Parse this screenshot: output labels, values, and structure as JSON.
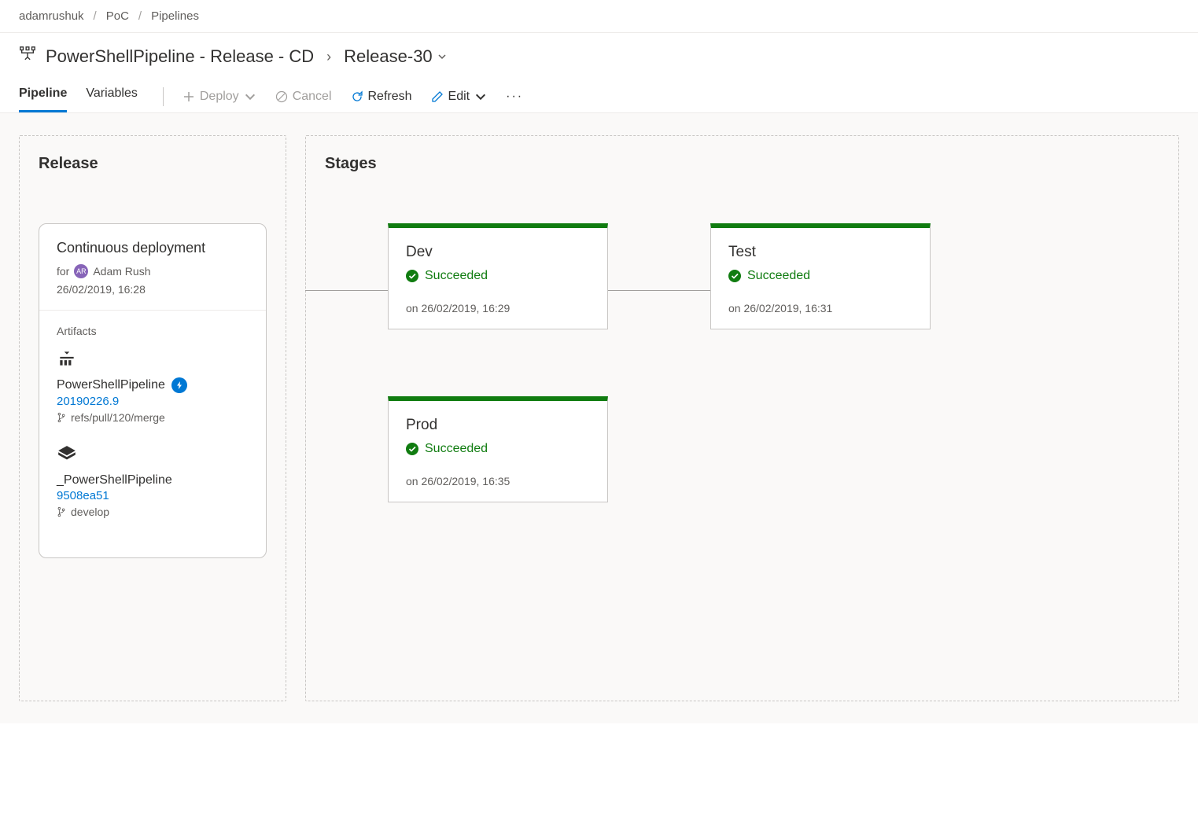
{
  "breadcrumb": {
    "org": "adamrushuk",
    "project": "PoC",
    "section": "Pipelines"
  },
  "title": {
    "pipeline_name": "PowerShellPipeline - Release - CD",
    "release_name": "Release-30"
  },
  "tabs": {
    "pipeline": "Pipeline",
    "variables": "Variables"
  },
  "toolbar": {
    "deploy": "Deploy",
    "cancel": "Cancel",
    "refresh": "Refresh",
    "edit": "Edit"
  },
  "release_panel": {
    "title": "Release",
    "trigger_title": "Continuous deployment",
    "creator_prefix": "for",
    "creator": "Adam Rush",
    "date": "26/02/2019, 16:28",
    "artifacts_label": "Artifacts",
    "artifacts": [
      {
        "name": "PowerShellPipeline",
        "version": "20190226.9",
        "branch": "refs/pull/120/merge",
        "has_trigger_badge": true,
        "icon": "build"
      },
      {
        "name": "_PowerShellPipeline",
        "version": "9508ea51",
        "branch": "develop",
        "has_trigger_badge": false,
        "icon": "repo"
      }
    ]
  },
  "stages_panel": {
    "title": "Stages",
    "stages": [
      {
        "key": "dev",
        "name": "Dev",
        "status": "Succeeded",
        "timestamp": "on 26/02/2019, 16:29"
      },
      {
        "key": "test",
        "name": "Test",
        "status": "Succeeded",
        "timestamp": "on 26/02/2019, 16:31"
      },
      {
        "key": "prod",
        "name": "Prod",
        "status": "Succeeded",
        "timestamp": "on 26/02/2019, 16:35"
      }
    ]
  }
}
